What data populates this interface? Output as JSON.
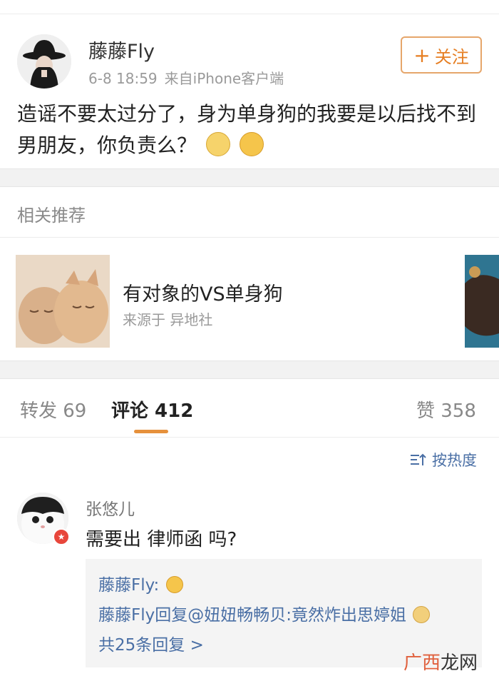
{
  "post": {
    "username": "藤藤Fly",
    "timestamp": "6-8 18:59",
    "source": "来自iPhone客户端",
    "follow_label": "关注",
    "follow_plus": "+",
    "text": "造谣不要太过分了，身为单身狗的我要是以后找不到男朋友，你负责么？"
  },
  "recommend": {
    "section_title": "相关推荐",
    "headline": "有对象的VS单身狗",
    "source": "来源于 异地社"
  },
  "tabs": {
    "repost": "转发 69",
    "comments": "评论 412",
    "likes": "赞 358"
  },
  "sort": {
    "label": "按热度"
  },
  "comment": {
    "name": "张悠儿",
    "text": "需要出 律师函 吗?",
    "replies": [
      {
        "text": "藤藤Fly:"
      },
      {
        "text": "藤藤Fly回复@妞妞畅畅贝:竟然炸出思婷姐"
      }
    ],
    "more_label": "共25条回复 >"
  },
  "watermark": {
    "part1": "广西",
    "part2": "龙网"
  },
  "colors": {
    "accent_orange": "#e67e22",
    "link_blue": "#4a6fa5",
    "badge_red": "#e8463b"
  }
}
